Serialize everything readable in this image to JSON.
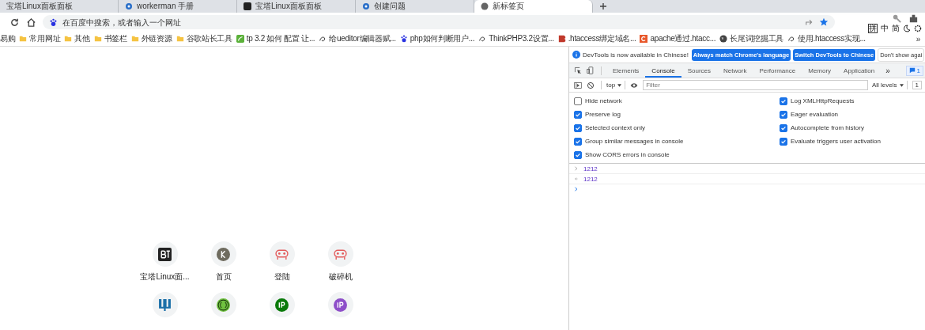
{
  "browser": {
    "tabs": [
      {
        "title": "宝塔Linux面板面板",
        "selected": false
      },
      {
        "title": "workerman 手册",
        "selected": false
      },
      {
        "title": "宝塔Linux面板面板",
        "selected": false
      },
      {
        "title": "创建问题",
        "selected": false
      },
      {
        "title": "新标签页",
        "selected": true
      }
    ],
    "address": {
      "placeholder": "在百度中搜索，或者输入一个网址"
    },
    "bookmarks": [
      {
        "label": "易购"
      },
      {
        "label": "常用网址"
      },
      {
        "label": "其他"
      },
      {
        "label": "书签栏"
      },
      {
        "label": "外链资源"
      },
      {
        "label": "谷歌站长工具"
      },
      {
        "label": "tp 3.2 如何 配置 让..."
      },
      {
        "label": "给ueditor编辑器赋..."
      },
      {
        "label": "php如何判断用户..."
      },
      {
        "label": "ThinkPHP3.2设置..."
      },
      {
        "label": ".htaccess绑定域名..."
      },
      {
        "label": "apache通过.htacc..."
      },
      {
        "label": "长尾词挖掘工具"
      },
      {
        "label": "使用.htaccess实现..."
      }
    ],
    "bookmarks_more": "»",
    "ime": [
      "拼",
      "中",
      "简"
    ]
  },
  "shortcuts": [
    {
      "label": "宝塔Linux面..."
    },
    {
      "label": "首页"
    },
    {
      "label": "登陆"
    },
    {
      "label": "破碎机"
    }
  ],
  "devtools": {
    "banner": {
      "text": "DevTools is now available in Chinese!",
      "buttons": [
        "Always match Chrome's language",
        "Switch DevTools to Chinese",
        "Don't show agai"
      ]
    },
    "tabs": [
      {
        "label": "Elements",
        "selected": false
      },
      {
        "label": "Console",
        "selected": true
      },
      {
        "label": "Sources",
        "selected": false
      },
      {
        "label": "Network",
        "selected": false
      },
      {
        "label": "Performance",
        "selected": false
      },
      {
        "label": "Memory",
        "selected": false
      },
      {
        "label": "Application",
        "selected": false
      }
    ],
    "more": "»",
    "issues_badge": "1",
    "context": "top",
    "filter_placeholder": "Filter",
    "levels": "All levels",
    "issues_count": "1",
    "settings": [
      {
        "label": "Hide network",
        "checked": false
      },
      {
        "label": "Log XMLHttpRequests",
        "checked": true
      },
      {
        "label": "Preserve log",
        "checked": true
      },
      {
        "label": "Eager evaluation",
        "checked": true
      },
      {
        "label": "Selected context only",
        "checked": true
      },
      {
        "label": "Autocomplete from history",
        "checked": true
      },
      {
        "label": "Group similar messages in console",
        "checked": true
      },
      {
        "label": "Evaluate triggers user activation",
        "checked": true
      },
      {
        "label": "Show CORS errors in console",
        "checked": true
      }
    ],
    "console": [
      {
        "kind": "input",
        "text": "1212"
      },
      {
        "kind": "result",
        "text": "1212"
      }
    ]
  }
}
